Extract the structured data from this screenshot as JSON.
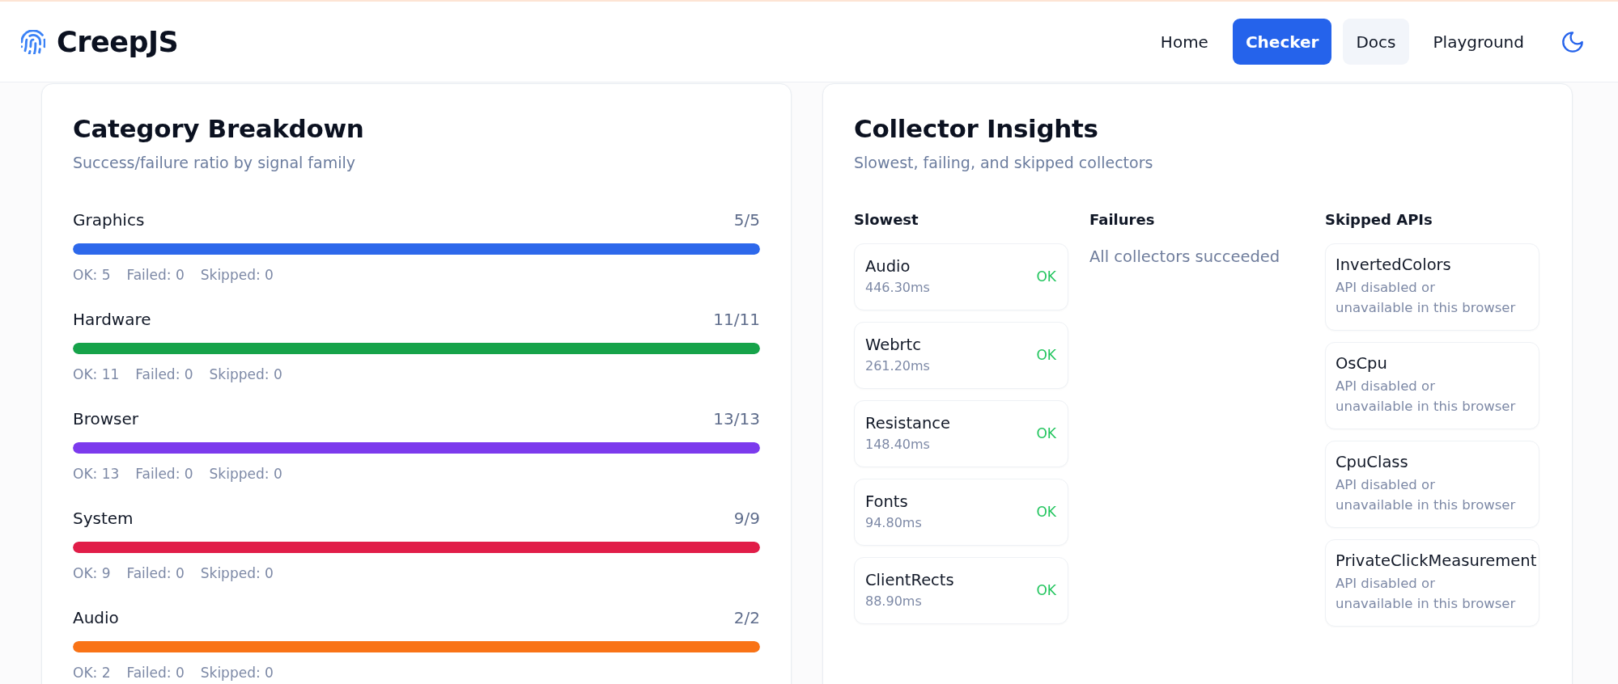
{
  "header": {
    "logo": "CreepJS",
    "nav": [
      {
        "label": "Home",
        "selected": false,
        "hovered": false
      },
      {
        "label": "Checker",
        "selected": true,
        "hovered": false
      },
      {
        "label": "Docs",
        "selected": false,
        "hovered": true
      },
      {
        "label": "Playground",
        "selected": false,
        "hovered": false
      }
    ]
  },
  "category_breakdown": {
    "title": "Category Breakdown",
    "subtitle": "Success/failure ratio by signal family",
    "categories": [
      {
        "name": "Graphics",
        "ratio": "5/5",
        "level": 1,
        "color": "#2d68eb",
        "stats": {
          "ok": "OK: 5",
          "failed": "Failed: 0",
          "skipped": "Skipped: 0"
        }
      },
      {
        "name": "Hardware",
        "ratio": "11/11",
        "level": 1,
        "color": "#16a34a",
        "stats": {
          "ok": "OK: 11",
          "failed": "Failed: 0",
          "skipped": "Skipped: 0"
        }
      },
      {
        "name": "Browser",
        "ratio": "13/13",
        "level": 1,
        "color": "#7c3aed",
        "stats": {
          "ok": "OK: 13",
          "failed": "Failed: 0",
          "skipped": "Skipped: 0"
        }
      },
      {
        "name": "System",
        "ratio": "9/9",
        "level": 1,
        "color": "#e11d48",
        "stats": {
          "ok": "OK: 9",
          "failed": "Failed: 0",
          "skipped": "Skipped: 0"
        }
      },
      {
        "name": "Audio",
        "ratio": "2/2",
        "level": 1,
        "color": "#f97316",
        "stats": {
          "ok": "OK: 2",
          "failed": "Failed: 0",
          "skipped": "Skipped: 0"
        }
      }
    ]
  },
  "collector_insights": {
    "title": "Collector Insights",
    "subtitle": "Slowest, failing, and skipped collectors",
    "slowest": {
      "heading": "Slowest",
      "items": [
        {
          "name": "Audio",
          "time": "446.30ms",
          "status": "OK"
        },
        {
          "name": "Webrtc",
          "time": "261.20ms",
          "status": "OK"
        },
        {
          "name": "Resistance",
          "time": "148.40ms",
          "status": "OK"
        },
        {
          "name": "Fonts",
          "time": "94.80ms",
          "status": "OK"
        },
        {
          "name": "ClientRects",
          "time": "88.90ms",
          "status": "OK"
        }
      ]
    },
    "failures": {
      "heading": "Failures",
      "message": "All collectors succeeded"
    },
    "skipped": {
      "heading": "Skipped APIs",
      "items": [
        {
          "name": "InvertedColors",
          "description": "API disabled or\nunavailable in this browser"
        },
        {
          "name": "OsCpu",
          "description": "API disabled or\nunavailable in this browser"
        },
        {
          "name": "CpuClass",
          "description": "API disabled or\nunavailable in this browser"
        },
        {
          "name": "PrivateClickMeasurement",
          "description": "API disabled or\nunavailable in this browser"
        }
      ]
    }
  }
}
